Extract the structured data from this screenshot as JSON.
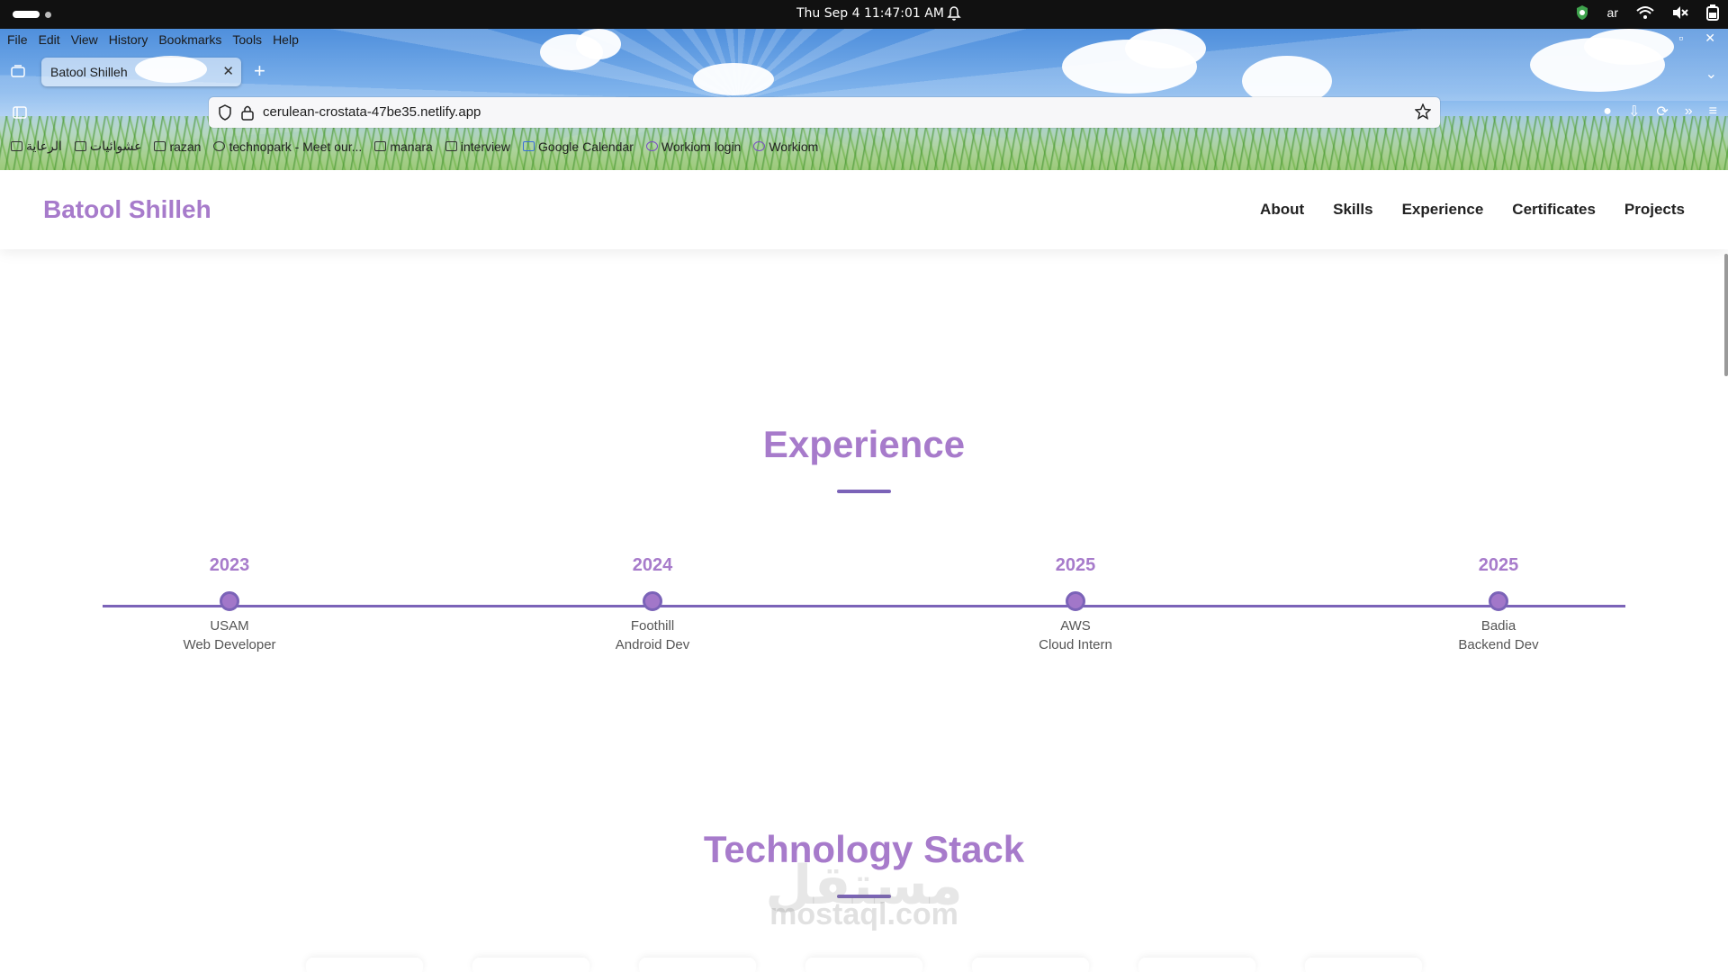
{
  "os": {
    "clock": "Thu Sep 4  11:47:01 AM",
    "input_lang": "ar"
  },
  "browser": {
    "menu": [
      "File",
      "Edit",
      "View",
      "History",
      "Bookmarks",
      "Tools",
      "Help"
    ],
    "tab_title": "Batool Shilleh",
    "url": "cerulean-crostata-47be35.netlify.app",
    "bookmarks": [
      "الرعاية",
      "عشوائيات",
      "razan",
      "technopark - Meet our...",
      "manara",
      "interview",
      "Google Calendar",
      "Workiom login",
      "Workiom"
    ]
  },
  "site": {
    "brand": "Batool Shilleh",
    "nav": [
      "About",
      "Skills",
      "Experience",
      "Certificates",
      "Projects"
    ],
    "accent": "#a77bcb",
    "line_color": "#7b63b8"
  },
  "experience": {
    "title": "Experience",
    "items": [
      {
        "year": "2023",
        "org": "USAM",
        "role": "Web Developer"
      },
      {
        "year": "2024",
        "org": "Foothill",
        "role": "Android Dev"
      },
      {
        "year": "2025",
        "org": "AWS",
        "role": "Cloud Intern"
      },
      {
        "year": "2025",
        "org": "Badia",
        "role": "Backend Dev"
      }
    ]
  },
  "tech_stack": {
    "title": "Technology Stack"
  },
  "watermark": {
    "latin": "mostaql.com",
    "arabic": "مستقل"
  }
}
